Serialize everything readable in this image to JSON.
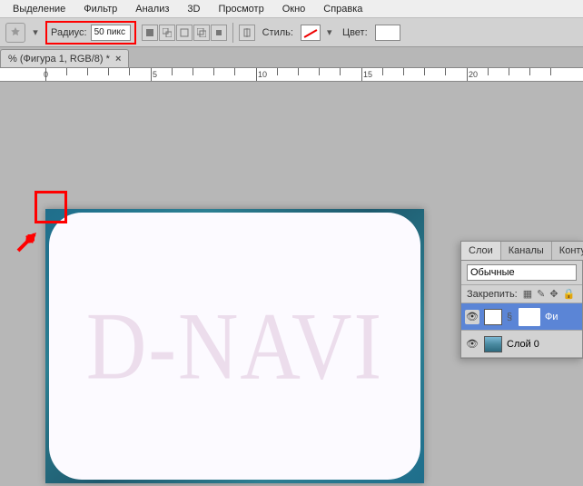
{
  "menu": {
    "items": [
      "Выделение",
      "Фильтр",
      "Анализ",
      "3D",
      "Просмотр",
      "Окно",
      "Справка"
    ]
  },
  "options": {
    "radius_label": "Радиус:",
    "radius_value": "50 пикс",
    "style_label": "Стиль:",
    "color_label": "Цвет:"
  },
  "doc": {
    "title": "% (Фигура 1, RGB/8) *"
  },
  "ruler": {
    "marks": [
      "0",
      "5",
      "10",
      "15",
      "20"
    ]
  },
  "canvas": {
    "watermark": "D-NAVI"
  },
  "panels": {
    "tabs": [
      "Слои",
      "Каналы",
      "Контур"
    ],
    "blend_mode": "Обычные",
    "lock_label": "Закрепить:",
    "layers": [
      {
        "name": "Фи",
        "type": "shape",
        "visible": true,
        "selected": true
      },
      {
        "name": "Слой 0",
        "type": "image",
        "visible": true,
        "selected": false
      }
    ]
  }
}
